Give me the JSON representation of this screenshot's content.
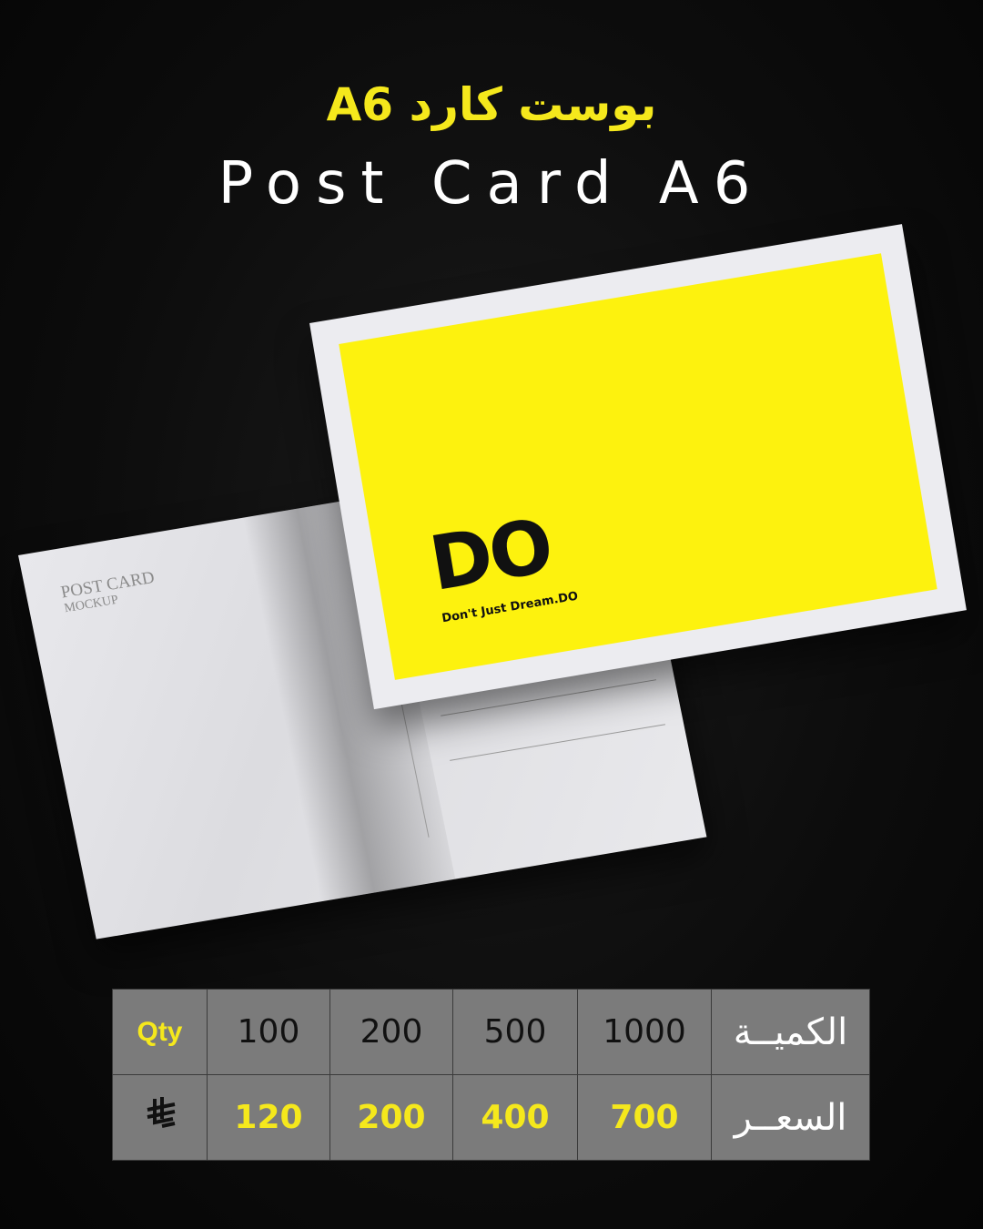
{
  "header": {
    "title_ar": "بوست كارد A6",
    "title_en": "Post Card A6"
  },
  "back_card": {
    "label_line1": "POST CARD",
    "label_line2": "MOCKUP"
  },
  "front_card": {
    "logo_text": "DO",
    "tagline": "Don't Just Dream.DO"
  },
  "table": {
    "qty_label_en": "Qty",
    "qty_label_ar": "الكميــة",
    "price_label_ar": "السعــر",
    "currency_icon": "saudi-riyal-icon",
    "quantities": [
      "100",
      "200",
      "500",
      "1000"
    ],
    "prices": [
      "120",
      "200",
      "400",
      "700"
    ]
  },
  "colors": {
    "accent_yellow": "#f5e81c",
    "card_yellow": "#fdf20e",
    "table_bg": "#7b7b7b",
    "background": "#0d0d0d"
  }
}
